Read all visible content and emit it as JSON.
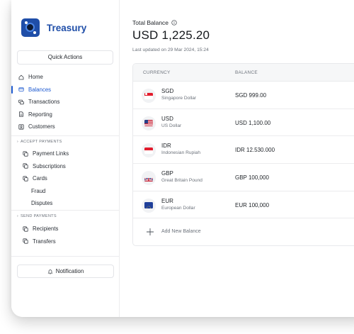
{
  "app": {
    "brand_name": "Treasury",
    "brand_color": "#1f4ea8",
    "accent_color": "#1f5bd1"
  },
  "sidebar": {
    "quick_actions_label": "Quick Actions",
    "main_items": [
      {
        "label": "Home",
        "icon": "home-icon"
      },
      {
        "label": "Balances",
        "icon": "wallet-icon",
        "active": true
      },
      {
        "label": "Transactions",
        "icon": "transactions-icon"
      },
      {
        "label": "Reporting",
        "icon": "document-icon"
      },
      {
        "label": "Customers",
        "icon": "contacts-icon"
      }
    ],
    "accept_payments_title": "ACCEPT PAYMENTS",
    "accept_items": [
      {
        "label": "Payment Links",
        "icon": "copy-icon"
      },
      {
        "label": "Subscriptions",
        "icon": "copy-icon"
      },
      {
        "label": "Cards",
        "icon": "copy-icon"
      },
      {
        "label": "Fraud"
      },
      {
        "label": "Disputes"
      }
    ],
    "send_payments_title": "SEND PAYMENTS",
    "send_items": [
      {
        "label": "Recipients",
        "icon": "copy-icon"
      },
      {
        "label": "Transfers",
        "icon": "copy-icon"
      }
    ],
    "notification_label": "Notification"
  },
  "main": {
    "total_balance_label": "Total Balance",
    "total_balance_value": "USD 1,225.20",
    "last_updated": "Last updated on 29 Mar 2024, 15:24",
    "table": {
      "col_currency": "CURRENCY",
      "col_balance": "BALANCE",
      "rows": [
        {
          "code": "SGD",
          "name": "Singapore Dollar",
          "balance": "SGD 999.00",
          "flag": "sg"
        },
        {
          "code": "USD",
          "name": "US Dollar",
          "balance": "USD 1,100.00",
          "flag": "us"
        },
        {
          "code": "IDR",
          "name": "Indonesian Rupiah",
          "balance": "IDR 12.530.000",
          "flag": "id"
        },
        {
          "code": "GBP",
          "name": "Great Britain Pound",
          "balance": "GBP 100,000",
          "flag": "gb"
        },
        {
          "code": "EUR",
          "name": "European Dollar",
          "balance": "EUR 100,000",
          "flag": "eu"
        }
      ],
      "add_label": "Add New Balance"
    }
  }
}
